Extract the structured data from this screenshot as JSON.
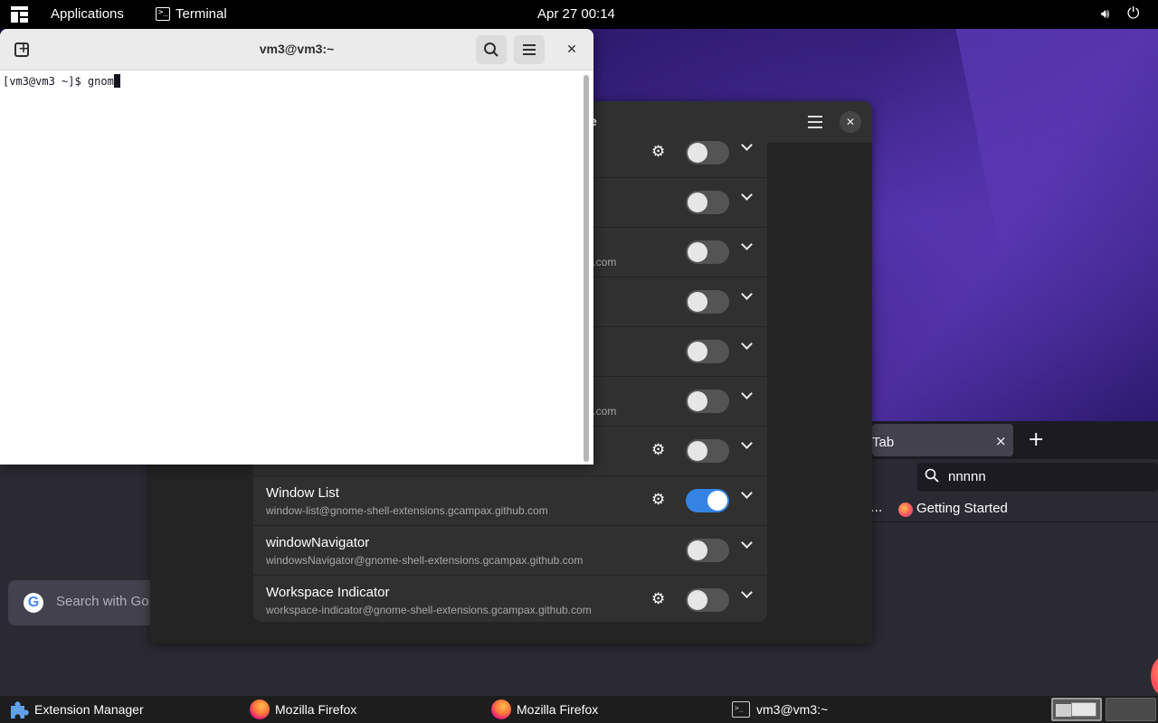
{
  "topbar": {
    "applications_label": "Applications",
    "active_app_label": "Terminal",
    "clock": "Apr 27  00:14",
    "volume_icon": "speaker-icon",
    "power_icon": "power-icon"
  },
  "firefox_right": {
    "tab_label": "Tab",
    "tab_close": "×",
    "new_tab": "+",
    "url_text": "nnnnn",
    "bookmark_overflow": "...",
    "bookmark_label": "Getting Started"
  },
  "firefox_left": {
    "search_placeholder": "Search with Go",
    "google_letter": "G"
  },
  "extension_manager": {
    "title_fragment": "e",
    "close_label": "✕",
    "rows": [
      {
        "name": "",
        "uuid": "m",
        "has_gear": true,
        "enabled": false
      },
      {
        "name": "",
        "uuid": "m",
        "has_gear": false,
        "enabled": false
      },
      {
        "name": "",
        "uuid": "ub.com",
        "has_gear": false,
        "enabled": false
      },
      {
        "name": "",
        "uuid": "",
        "has_gear": false,
        "enabled": false
      },
      {
        "name": "",
        "uuid": "",
        "has_gear": false,
        "enabled": false
      },
      {
        "name": "",
        "uuid": "ub.com",
        "has_gear": false,
        "enabled": false
      },
      {
        "name": "",
        "uuid": "",
        "has_gear": true,
        "enabled": false
      },
      {
        "name": "Window List",
        "uuid": "window-list@gnome-shell-extensions.gcampax.github.com",
        "has_gear": true,
        "enabled": true
      },
      {
        "name": "windowNavigator",
        "uuid": "windowsNavigator@gnome-shell-extensions.gcampax.github.com",
        "has_gear": false,
        "enabled": false
      },
      {
        "name": "Workspace Indicator",
        "uuid": "workspace-indicator@gnome-shell-extensions.gcampax.github.com",
        "has_gear": true,
        "enabled": false
      }
    ]
  },
  "terminal": {
    "title": "vm3@vm3:~",
    "prompt": "[vm3@vm3 ~]$ ",
    "typed": "gnom",
    "close_label": "✕"
  },
  "bottombar": {
    "items": [
      {
        "label": "Extension Manager",
        "icon": "puzzle-icon"
      },
      {
        "label": "Mozilla Firefox",
        "icon": "firefox-icon"
      },
      {
        "label": "Mozilla Firefox",
        "icon": "firefox-icon"
      },
      {
        "label": "vm3@vm3:~",
        "icon": "terminal-icon"
      }
    ]
  },
  "colors": {
    "accent": "#3584e4",
    "panel_bg": "#000000",
    "ext_list_bg": "#303030"
  }
}
